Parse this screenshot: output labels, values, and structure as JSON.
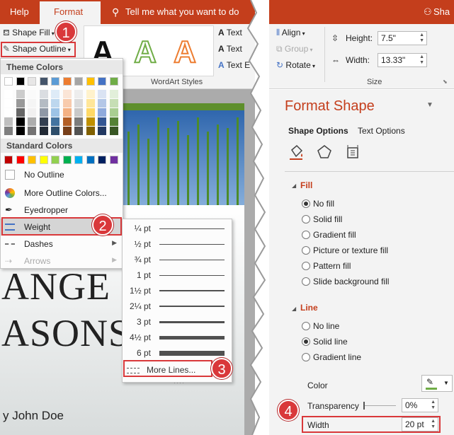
{
  "left": {
    "tabs": {
      "help": "Help",
      "format": "Format",
      "tell_me": "Tell me what you want to do"
    },
    "ribbon": {
      "shape_fill": "Shape Fill",
      "shape_outline": "Shape Outline",
      "wordart_letter": "A",
      "text_fill": "Text",
      "text_outline": "Text",
      "text_effects": "Text E",
      "wordart_group_label": "WordArt Styles"
    },
    "outline_menu": {
      "theme_colors_header": "Theme Colors",
      "standard_colors_header": "Standard Colors",
      "theme_top_row": [
        "#ffffff",
        "#000000",
        "#e7e6e6",
        "#44546a",
        "#5b9bd5",
        "#ed7d31",
        "#a5a5a5",
        "#ffc000",
        "#4472c4",
        "#70ad47"
      ],
      "standard_colors": [
        "#c00000",
        "#ff0000",
        "#ffc000",
        "#ffff00",
        "#92d050",
        "#00b050",
        "#00b0f0",
        "#0070c0",
        "#002060",
        "#7030a0"
      ],
      "no_outline": "No Outline",
      "more_outline_colors": "More Outline Colors...",
      "eyedropper": "Eyedropper",
      "weight": "Weight",
      "dashes": "Dashes",
      "arrows": "Arrows"
    },
    "weight_menu": {
      "items": [
        {
          "label": "¼ pt",
          "pt": 0.25
        },
        {
          "label": "½ pt",
          "pt": 0.5
        },
        {
          "label": "¾ pt",
          "pt": 0.75
        },
        {
          "label": "1 pt",
          "pt": 1
        },
        {
          "label": "1½ pt",
          "pt": 1.5
        },
        {
          "label": "2¼ pt",
          "pt": 2.25
        },
        {
          "label": "3 pt",
          "pt": 3
        },
        {
          "label": "4½ pt",
          "pt": 4.5
        },
        {
          "label": "6 pt",
          "pt": 6
        }
      ],
      "more_lines": "More Lines..."
    },
    "slide": {
      "line1": "ANGE C",
      "line2": "ASONS",
      "author": "y John Doe"
    },
    "callouts": {
      "c1": "1",
      "c2": "2",
      "c3": "3",
      "c4": "4"
    }
  },
  "right": {
    "user": "Sha",
    "ribbon": {
      "align": "Align",
      "group": "Group",
      "rotate": "Rotate",
      "height_label": "Height:",
      "height_value": "7.5\"",
      "width_label": "Width:",
      "width_value": "13.33\"",
      "size_group_label": "Size"
    },
    "pane": {
      "title": "Format Shape",
      "tab_shape_options": "Shape Options",
      "tab_text_options": "Text Options",
      "fill_header": "Fill",
      "fill_options": [
        "No fill",
        "Solid fill",
        "Gradient fill",
        "Picture or texture fill",
        "Pattern fill",
        "Slide background fill"
      ],
      "fill_selected": 0,
      "line_header": "Line",
      "line_options": [
        "No line",
        "Solid line",
        "Gradient line"
      ],
      "line_selected": 1,
      "color_label": "Color",
      "transparency_label": "Transparency",
      "transparency_value": "0%",
      "width_label": "Width",
      "width_value": "20 pt"
    }
  },
  "colors": {
    "accent": "#c43e1c",
    "callout": "#d9383a"
  }
}
